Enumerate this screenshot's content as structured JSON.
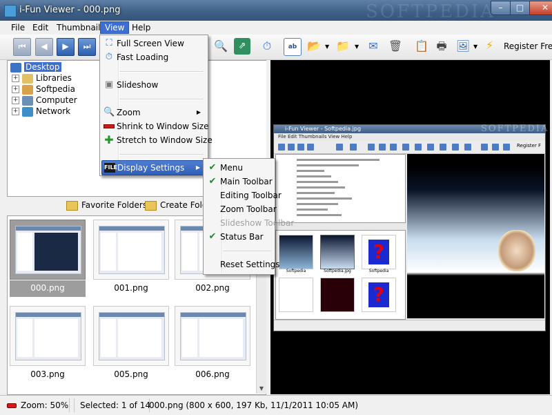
{
  "window": {
    "title": "i-Fun Viewer - 000.png",
    "watermark": "SOFTPEDIA",
    "minimize_glyph": "–",
    "maximize_glyph": "□",
    "close_glyph": "✕"
  },
  "menubar": {
    "items": [
      "File",
      "Edit",
      "Thumbnails",
      "View",
      "Help"
    ],
    "active": "View"
  },
  "toolbar": {
    "register_label": "Register Free"
  },
  "tree": {
    "nodes": [
      "Desktop",
      "Libraries",
      "Softpedia",
      "Computer",
      "Network"
    ],
    "selected": "Desktop",
    "expander": "+"
  },
  "folder_bar": {
    "favorite": "Favorite Folders",
    "create": "Create Folder"
  },
  "thumbnails": {
    "items": [
      "000.png",
      "001.png",
      "002.png",
      "003.png",
      "005.png",
      "006.png"
    ],
    "selected": "000.png",
    "scroll_up": "▲",
    "scroll_down": "▼"
  },
  "view_menu": {
    "items": {
      "full_screen": "Full Screen View",
      "fast_loading": "Fast Loading",
      "slideshow": "Slideshow",
      "zoom": "Zoom",
      "shrink": "Shrink to Window Size",
      "stretch": "Stretch to Window Size",
      "display_settings": "Display Settings"
    },
    "submenu_arrow": "▶"
  },
  "display_menu": {
    "items": [
      {
        "label": "Menu",
        "checked": true,
        "enabled": true
      },
      {
        "label": "Main Toolbar",
        "checked": true,
        "enabled": true
      },
      {
        "label": "Editing Toolbar",
        "checked": false,
        "enabled": true
      },
      {
        "label": "Zoom Toolbar",
        "checked": false,
        "enabled": true
      },
      {
        "label": "Slideshow Toolbar",
        "checked": false,
        "enabled": false
      },
      {
        "label": "Status Bar",
        "checked": true,
        "enabled": true
      },
      {
        "label": "Reset Settings",
        "checked": false,
        "enabled": true
      }
    ],
    "check_glyph": "✔"
  },
  "inner_screenshot": {
    "title": "i-Fun Viewer - Softpedia.jpg",
    "menu": "File  Edit  Thumbnails  View  Help",
    "register": "Register F",
    "thumb_labels": [
      "Softpedia",
      "Softpedia.jpg",
      "Softpedia"
    ]
  },
  "statusbar": {
    "zoom": "Zoom: 50%",
    "selection": "Selected: 1 of 14",
    "file_info": "000.png  (800 x 600, 197 Kb, 11/1/2011 10:05 AM)"
  },
  "colors": {
    "accent": "#3d6fd1",
    "titlebar": "#3e5f86",
    "check": "#1d8a2a"
  }
}
